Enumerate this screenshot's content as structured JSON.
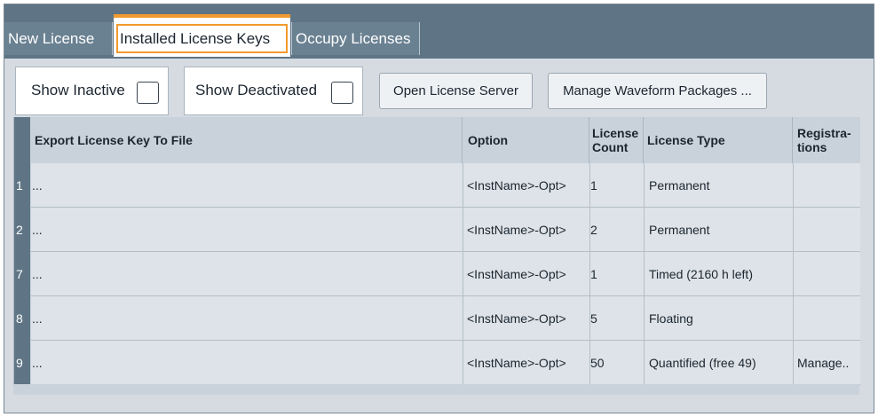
{
  "tabs": {
    "new_license": "New License",
    "installed_keys": "Installed License Keys",
    "occupy": "Occupy Licenses"
  },
  "toolbar": {
    "show_inactive": "Show Inactive",
    "show_deactivated": "Show Deactivated",
    "open_server": "Open License Server",
    "manage_waveform": "Manage Waveform Packages ..."
  },
  "table": {
    "headers": {
      "export": "Export License Key To File",
      "option": "Option",
      "count": "License Count",
      "type": "License Type",
      "registrations": "Registra-tions"
    },
    "rows": [
      {
        "num": "1",
        "export": "...",
        "option": "<InstName>-Opt>",
        "count": "1",
        "type": "Permanent",
        "registrations": ""
      },
      {
        "num": "2",
        "export": "...",
        "option": "<InstName>-Opt>",
        "count": "2",
        "type": "Permanent",
        "registrations": ""
      },
      {
        "num": "7",
        "export": "...",
        "option": "<InstName>-Opt>",
        "count": "1",
        "type": "Timed (2160 h left)",
        "registrations": ""
      },
      {
        "num": "8",
        "export": "...",
        "option": "<InstName>-Opt>",
        "count": "5",
        "type": "Floating",
        "registrations": ""
      },
      {
        "num": "9",
        "export": "...",
        "option": "<InstName>-Opt>",
        "count": "50",
        "type": "Quantified (free 49)",
        "registrations": "Manage.."
      }
    ]
  },
  "colors": {
    "tabbar": "#5f7585",
    "accent": "#f29a2e",
    "panel": "#d5dbe1"
  }
}
